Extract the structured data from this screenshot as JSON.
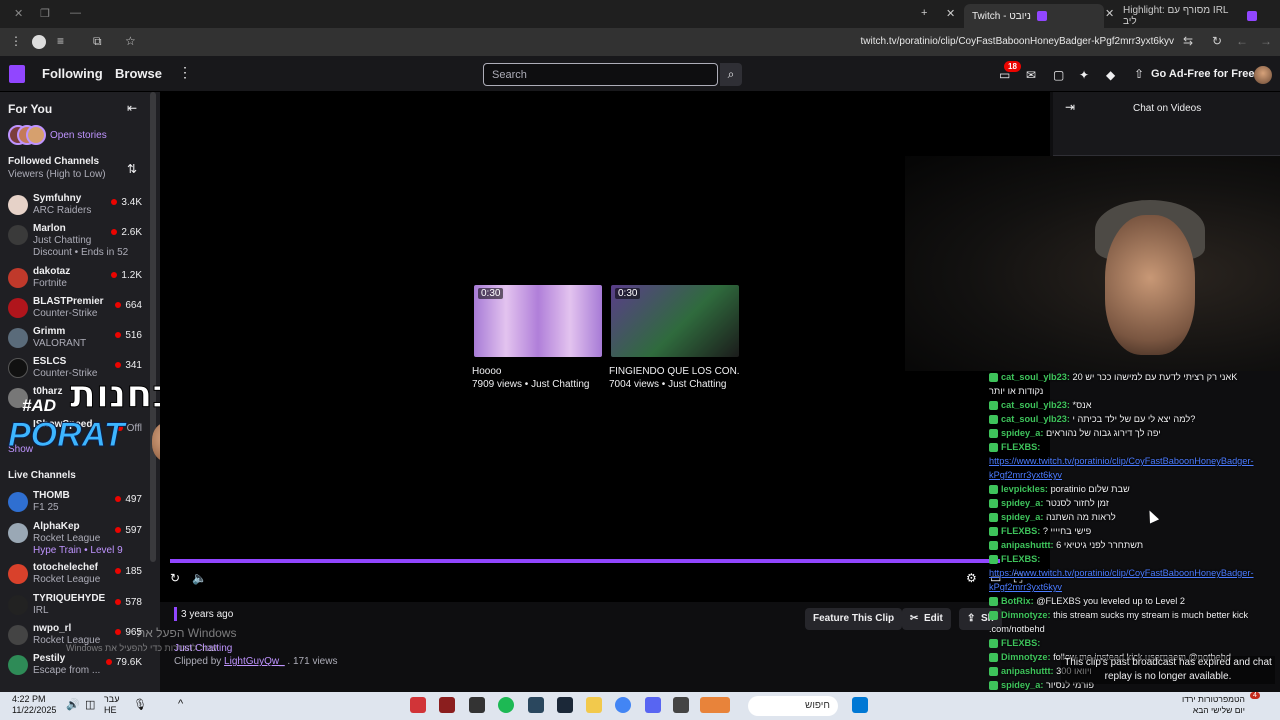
{
  "browser": {
    "tabs": [
      {
        "label": "Twitch - ניובט",
        "active": true
      },
      {
        "label": "Highlight: מסורף עם IRL ליב",
        "active": false
      }
    ],
    "url": "twitch.tv/poratinio/clip/CoyFastBaboonHoneyBadger-kPgf2mrr3yxt6kyv"
  },
  "topnav": {
    "following": "Following",
    "browse": "Browse",
    "search_placeholder": "Search",
    "notifications_count": "18",
    "ad_free": "Go Ad-Free for Free"
  },
  "sidebar": {
    "title": "For You",
    "open_stories": "Open stories",
    "followed_title": "Followed Channels",
    "followed_sort": "Viewers (High to Low)",
    "followed": [
      {
        "name": "Symfuhny",
        "game": "ARC Raiders",
        "viewers": "3.4K"
      },
      {
        "name": "Marlon",
        "game": "Just Chatting",
        "viewers": "2.6K",
        "extra": "Discount • Ends in 52"
      },
      {
        "name": "dakotaz",
        "game": "Fortnite",
        "viewers": "1.2K"
      },
      {
        "name": "BLASTPremier",
        "game": "Counter-Strike",
        "viewers": "664"
      },
      {
        "name": "Grimm",
        "game": "VALORANT",
        "viewers": "516"
      },
      {
        "name": "ESLCS",
        "game": "Counter-Strike",
        "viewers": "341"
      },
      {
        "name": "t0harz",
        "game": "",
        "viewers": ""
      },
      {
        "name": "IShowSpeed",
        "game": "",
        "viewers": "Offl"
      }
    ],
    "show_more": "Show",
    "live_title": "Live Channels",
    "live": [
      {
        "name": "THOMB",
        "game": "F1 25",
        "viewers": "497"
      },
      {
        "name": "AlphaKep",
        "game": "Rocket League",
        "viewers": "597",
        "extra": "Hype Train • Level 9"
      },
      {
        "name": "totochelechef",
        "game": "Rocket League",
        "viewers": "185"
      },
      {
        "name": "TYRIQUEHYDE",
        "game": "IRL",
        "viewers": "578"
      },
      {
        "name": "nwpo_rl",
        "game": "Rocket League",
        "viewers": "965"
      },
      {
        "name": "Pestily",
        "game": "Escape from ...",
        "viewers": "79.6K"
      }
    ]
  },
  "overlay": {
    "hebrew": "קוד בחנות",
    "ad": "#AD",
    "porat": "PORAT"
  },
  "player": {
    "clips": [
      {
        "duration": "0:30",
        "title": "Hoooo",
        "stats": "7909 views • Just Chatting"
      },
      {
        "duration": "0:30",
        "title": "FINGIENDO QUE LOS CON...",
        "stats": "7004 views • Just Chatting"
      }
    ]
  },
  "meta": {
    "age": "3 years ago",
    "category": "Just Chatting",
    "clipped_by_prefix": "Clipped by",
    "clipper": "LightGuyQw_",
    "views": ". 171 views",
    "feature_btn": "Feature This Clip",
    "edit_btn": "Edit",
    "share_btn": "Sh",
    "watermark": "הפעל את Windows",
    "watermark2": "Windows עבור להגדרות כדי להפעיל את"
  },
  "chat": {
    "header": "Chat on Videos",
    "lines": [
      {
        "user": "cat_soul_ylb23:",
        "text": "אני רק רציתי לדעת עם למישהו ככר יש 20K"
      },
      {
        "user": "",
        "text": "נקודות או יותר"
      },
      {
        "user": "cat_soul_ylb23:",
        "text": "*אנס"
      },
      {
        "user": "cat_soul_ylb23:",
        "text": "למה יצא לי עם של ילד בכיתה י?"
      },
      {
        "user": "spidey_a:",
        "text": "יפה לך דירוג גבוה של נהוראים"
      },
      {
        "user": "FLEXBS:",
        "text": ""
      },
      {
        "user": "",
        "text": "https://www.twitch.tv/poratinio/clip/CoyFastBaboonHoneyBadger-",
        "link": true
      },
      {
        "user": "",
        "text": "kPgf2mrr3yxt6kyv",
        "link": true
      },
      {
        "user": "levpickles:",
        "text": "poratinio שבת שלום"
      },
      {
        "user": "spidey_a:",
        "text": "זמן לחזור לסנטר"
      },
      {
        "user": "spidey_a:",
        "text": "לראות מה השתנה"
      },
      {
        "user": "FLEXBS:",
        "text": "? פישי בחיייי"
      },
      {
        "user": "anipashuttt:",
        "text": "תשתחרר לפני גיטיאי 6"
      },
      {
        "user": "FLEXBS:",
        "text": ""
      },
      {
        "user": "",
        "text": "https://www.twitch.tv/poratinio/clip/CoyFastBaboonHoneyBadger-",
        "link": true
      },
      {
        "user": "",
        "text": "kPgf2mrr3yxt6kyv",
        "link": true
      },
      {
        "user": "BotRix:",
        "text": "@FLEXBS you leveled up to Level 2"
      },
      {
        "user": "Dimnotyze:",
        "text": "this stream sucks my stream is much better kick"
      },
      {
        "user": "",
        "text": ".com/notbehd"
      },
      {
        "user": "FLEXBS:",
        "text": ""
      },
      {
        "user": "Dimnotyze:",
        "text": "follow me instead kick usernaem @notbehd"
      },
      {
        "user": "anipashuttt:",
        "text": "300 ויוואו"
      },
      {
        "user": "spidey_a:",
        "text": "פורמי לנסיור"
      }
    ],
    "expired": "This clip's past broadcast has expired and chat replay is no longer available."
  },
  "taskbar": {
    "time": "4:22 PM",
    "date": "11/22/2025",
    "lang1": "עבר",
    "lang2": "HE",
    "search": "חיפוש",
    "weather1": "הטמפרטורות ירדו",
    "weather2": "יום שלישי הבא",
    "notif": "4"
  }
}
